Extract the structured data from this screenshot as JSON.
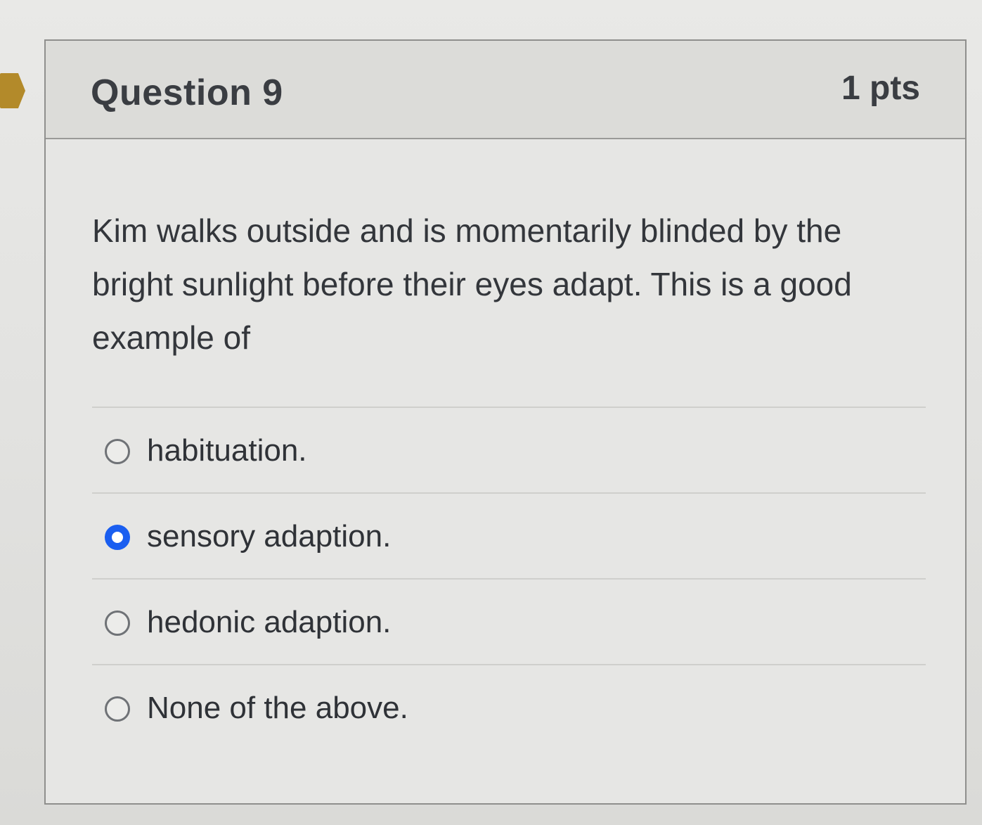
{
  "question": {
    "title": "Question 9",
    "points": "1 pts",
    "text": "Kim walks outside and is momentarily blinded by the bright sunlight before their eyes adapt. This is a good example of"
  },
  "answers": [
    {
      "label": "habituation.",
      "selected": false
    },
    {
      "label": "sensory adaption.",
      "selected": true
    },
    {
      "label": "hedonic adaption.",
      "selected": false
    },
    {
      "label": "None of the above.",
      "selected": false
    }
  ],
  "colors": {
    "selected_radio": "#1a5ef0",
    "flag_marker": "#b38a2a"
  }
}
